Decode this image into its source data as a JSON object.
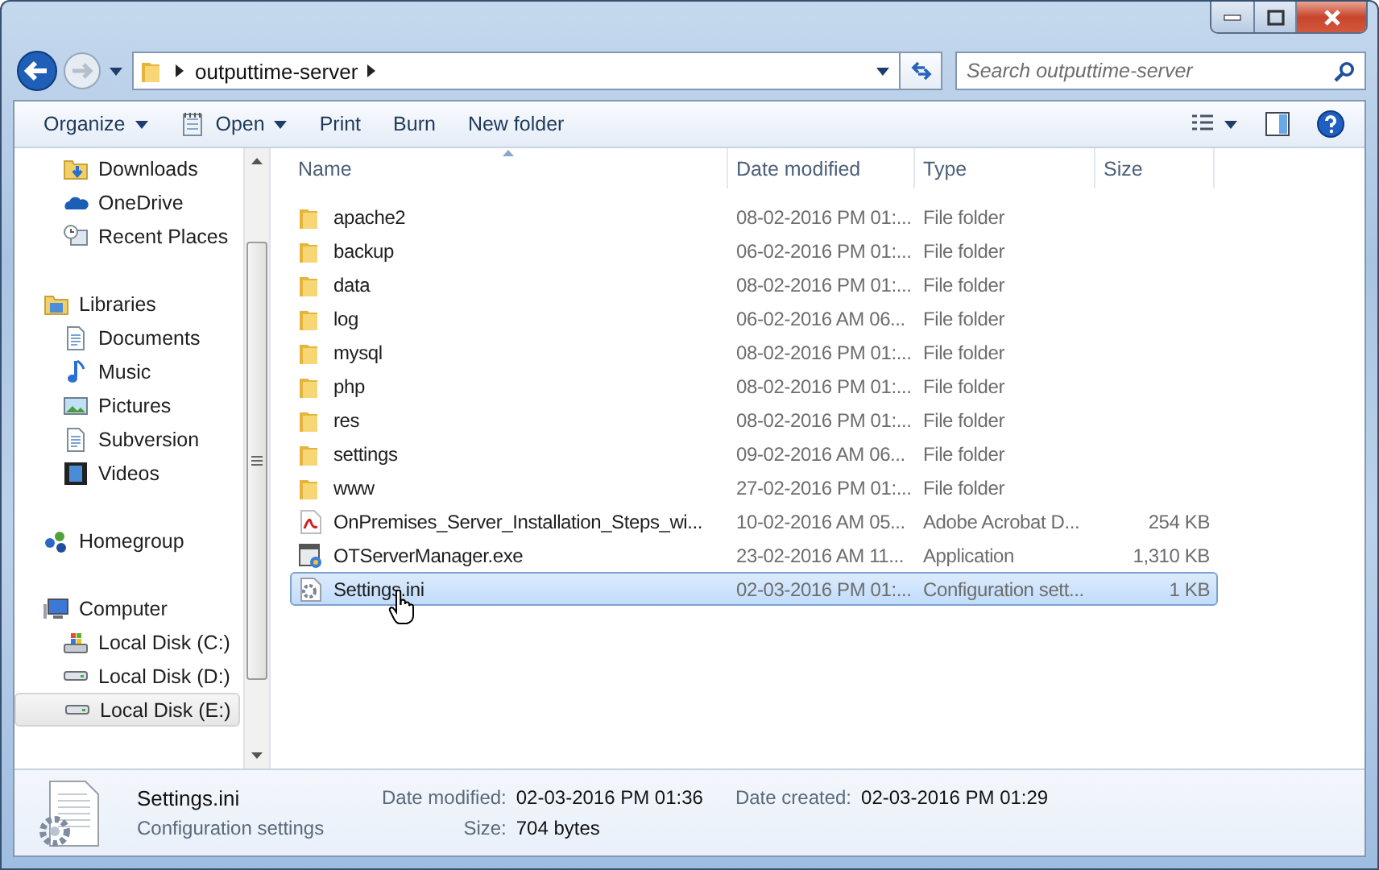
{
  "address": {
    "path": [
      "outputtime-server"
    ],
    "search_placeholder": "Search outputtime-server"
  },
  "toolbar": {
    "buttons": [
      {
        "label": "Organize",
        "dropdown": true,
        "kind": "plain"
      },
      {
        "label": "Open",
        "dropdown": true,
        "kind": "open"
      },
      {
        "label": "Print",
        "dropdown": false,
        "kind": "plain"
      },
      {
        "label": "Burn",
        "dropdown": false,
        "kind": "plain"
      },
      {
        "label": "New folder",
        "dropdown": false,
        "kind": "plain"
      }
    ]
  },
  "nav": {
    "sections": [
      {
        "children": [
          {
            "label": "Downloads",
            "selected": false
          },
          {
            "label": "OneDrive",
            "selected": false
          },
          {
            "label": "Recent Places",
            "selected": false
          }
        ]
      },
      {
        "label": "Libraries",
        "children": [
          {
            "label": "Documents",
            "selected": false
          },
          {
            "label": "Music",
            "selected": false
          },
          {
            "label": "Pictures",
            "selected": false
          },
          {
            "label": "Subversion",
            "selected": false
          },
          {
            "label": "Videos",
            "selected": false
          }
        ]
      },
      {
        "label": "Homegroup"
      },
      {
        "label": "Computer",
        "children": [
          {
            "label": "Local Disk (C:)",
            "selected": false
          },
          {
            "label": "Local Disk (D:)",
            "selected": false
          },
          {
            "label": "Local Disk (E:)",
            "selected": true
          }
        ]
      }
    ]
  },
  "table": {
    "columns": [
      "Name",
      "Date modified",
      "Type",
      "Size"
    ],
    "rows": [
      {
        "kind": "folder",
        "name": "apache2",
        "date": "08-02-2016 PM 01:...",
        "type": "File folder",
        "selected": false
      },
      {
        "kind": "folder",
        "name": "backup",
        "date": "06-02-2016 PM 01:...",
        "type": "File folder",
        "selected": false
      },
      {
        "kind": "folder",
        "name": "data",
        "date": "08-02-2016 PM 01:...",
        "type": "File folder",
        "selected": false
      },
      {
        "kind": "folder",
        "name": "log",
        "date": "06-02-2016 AM 06...",
        "type": "File folder",
        "selected": false
      },
      {
        "kind": "folder",
        "name": "mysql",
        "date": "08-02-2016 PM 01:...",
        "type": "File folder",
        "selected": false
      },
      {
        "kind": "folder",
        "name": "php",
        "date": "08-02-2016 PM 01:...",
        "type": "File folder",
        "selected": false
      },
      {
        "kind": "folder",
        "name": "res",
        "date": "08-02-2016 PM 01:...",
        "type": "File folder",
        "selected": false
      },
      {
        "kind": "folder",
        "name": "settings",
        "date": "09-02-2016 AM 06...",
        "type": "File folder",
        "selected": false
      },
      {
        "kind": "folder",
        "name": "www",
        "date": "27-02-2016 PM 01:...",
        "type": "File folder",
        "selected": false
      },
      {
        "kind": "pdf",
        "name": "OnPremises_Server_Installation_Steps_wi...",
        "date": "10-02-2016 AM 05...",
        "type": "Adobe Acrobat D...",
        "size": "254 KB",
        "selected": false
      },
      {
        "kind": "exe",
        "name": "OTServerManager.exe",
        "date": "23-02-2016 AM 11...",
        "type": "Application",
        "size": "1,310 KB",
        "selected": false
      },
      {
        "kind": "ini",
        "name": "Settings.ini",
        "date": "02-03-2016 PM 01:...",
        "type": "Configuration sett...",
        "size": "1 KB",
        "selected": true
      }
    ]
  },
  "details": {
    "name": "Settings.ini",
    "type": "Configuration settings",
    "fields": [
      {
        "label": "Date modified:",
        "value": "02-03-2016 PM 01:36"
      },
      {
        "label": "Size:",
        "value": "704 bytes"
      },
      {
        "label": "Date created:",
        "value": "02-03-2016 PM 01:29"
      }
    ]
  }
}
